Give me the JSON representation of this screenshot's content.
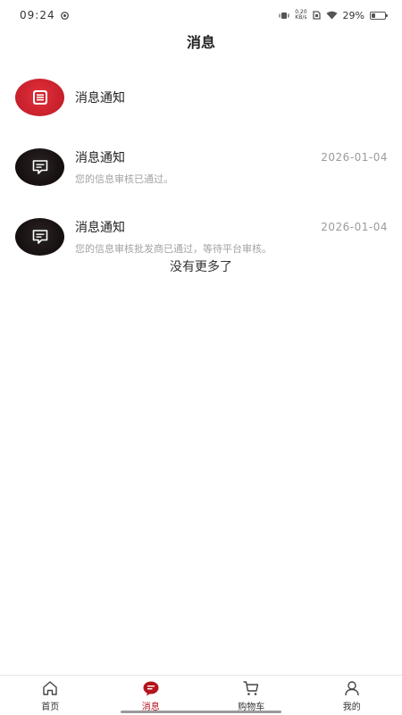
{
  "status_bar": {
    "time": "09:24",
    "net_speed_value": "0.20",
    "net_speed_unit": "KB/s",
    "battery": "29%",
    "battery_level": 0.29
  },
  "header": {
    "title": "消息"
  },
  "messages": [
    {
      "title": "消息通知",
      "date": "",
      "text": "",
      "avatar_color": "#c8202c",
      "icon": "notification-list-icon"
    },
    {
      "title": "消息通知",
      "date": "2026-01-04",
      "text": "您的信息审核已通过。",
      "avatar_color": "#1a1414",
      "icon": "chat-bubble-icon"
    },
    {
      "title": "消息通知",
      "date": "2026-01-04",
      "text": "您的信息审核批发商已通过，等待平台审核。",
      "avatar_color": "#1a1414",
      "icon": "chat-bubble-icon"
    }
  ],
  "list_end_text": "没有更多了",
  "tabbar": {
    "accent_color": "#b3131d",
    "items": [
      {
        "label": "首页",
        "icon": "home-icon",
        "active": false
      },
      {
        "label": "消息",
        "icon": "message-icon",
        "active": true
      },
      {
        "label": "购物车",
        "icon": "cart-icon",
        "active": false
      },
      {
        "label": "我的",
        "icon": "user-icon",
        "active": false
      }
    ]
  }
}
